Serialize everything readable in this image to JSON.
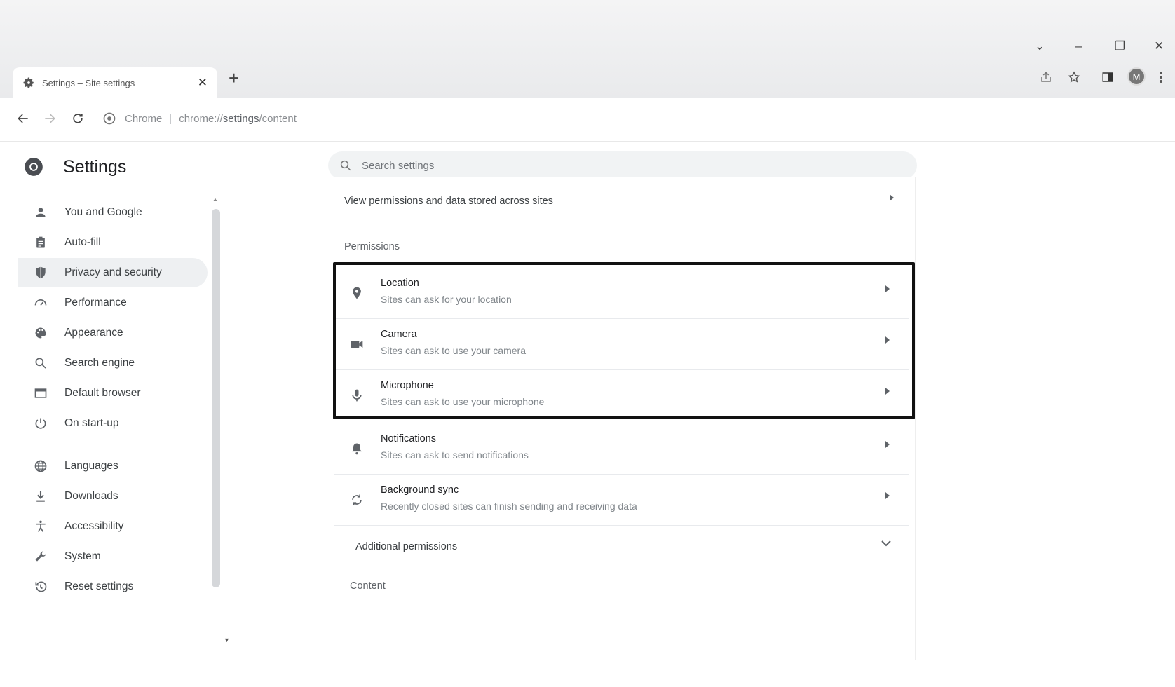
{
  "browser": {
    "tab_title": "Settings – Site settings",
    "tab_close": "✕",
    "new_tab": "+",
    "omnibox": {
      "chip": "Chrome",
      "separator": "|",
      "url_scheme": "chrome://",
      "url_host": "settings",
      "url_path": "/content"
    },
    "profile_initial": "M",
    "window_controls": {
      "minimize": "–",
      "maximize": "❐",
      "close": "✕",
      "tab_search": "⌄"
    }
  },
  "header": {
    "title": "Settings",
    "search_placeholder": "Search settings"
  },
  "sidebar": {
    "items": [
      {
        "label": "You and Google",
        "icon": "person-icon"
      },
      {
        "label": "Auto-fill",
        "icon": "clipboard-icon"
      },
      {
        "label": "Privacy and security",
        "icon": "shield-icon",
        "active": true
      },
      {
        "label": "Performance",
        "icon": "gauge-icon"
      },
      {
        "label": "Appearance",
        "icon": "palette-icon"
      },
      {
        "label": "Search engine",
        "icon": "search-icon"
      },
      {
        "label": "Default browser",
        "icon": "browser-window-icon"
      },
      {
        "label": "On start-up",
        "icon": "power-icon"
      },
      {
        "label": "Languages",
        "icon": "globe-icon"
      },
      {
        "label": "Downloads",
        "icon": "download-icon"
      },
      {
        "label": "Accessibility",
        "icon": "accessibility-icon"
      },
      {
        "label": "System",
        "icon": "wrench-icon"
      },
      {
        "label": "Reset settings",
        "icon": "restore-icon"
      }
    ]
  },
  "main": {
    "view_all_label": "View permissions and data stored across sites",
    "permissions_heading": "Permissions",
    "permissions": [
      {
        "title": "Location",
        "subtitle": "Sites can ask for your location",
        "icon": "location-pin-icon"
      },
      {
        "title": "Camera",
        "subtitle": "Sites can ask to use your camera",
        "icon": "camera-icon"
      },
      {
        "title": "Microphone",
        "subtitle": "Sites can ask to use your microphone",
        "icon": "microphone-icon"
      },
      {
        "title": "Notifications",
        "subtitle": "Sites can ask to send notifications",
        "icon": "bell-icon"
      },
      {
        "title": "Background sync",
        "subtitle": "Recently closed sites can finish sending and receiving data",
        "icon": "sync-icon"
      }
    ],
    "additional_permissions_label": "Additional permissions",
    "content_heading": "Content"
  },
  "colors": {
    "highlight_border": "#111111",
    "active_nav_bg": "#eef0f2",
    "titlebar_bg": "#e9eaec"
  }
}
